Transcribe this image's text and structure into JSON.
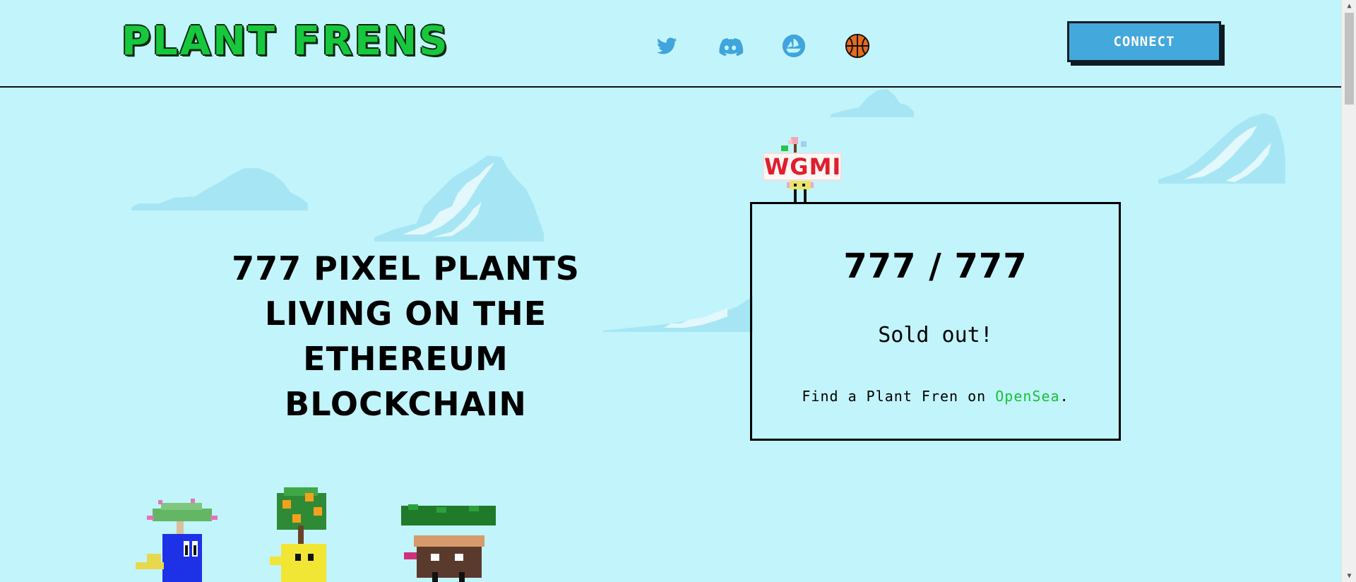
{
  "header": {
    "logo_text": "PLANT FRENS",
    "connect_label": "CONNECT",
    "social_links": [
      {
        "icon": "twitter-icon"
      },
      {
        "icon": "discord-icon"
      },
      {
        "icon": "opensea-icon"
      },
      {
        "icon": "basketball-icon"
      }
    ]
  },
  "hero": {
    "headline_lines": [
      "777 PIXEL PLANTS",
      "LIVING ON THE",
      "ETHEREUM BLOCKCHAIN"
    ]
  },
  "mint": {
    "count": "777 / 777",
    "status": "Sold out!",
    "find_prefix": "Find a Plant Fren on ",
    "find_link": "OpenSea",
    "find_suffix": "."
  },
  "mascot": {
    "sign_text": "WGMI"
  },
  "colors": {
    "background": "#c2f4fc",
    "logo_green": "#17c73d",
    "button_blue": "#43a8dc",
    "icon_blue": "#3fa5dc",
    "link_green": "#19c03a",
    "sign_red": "#e01e2e"
  }
}
